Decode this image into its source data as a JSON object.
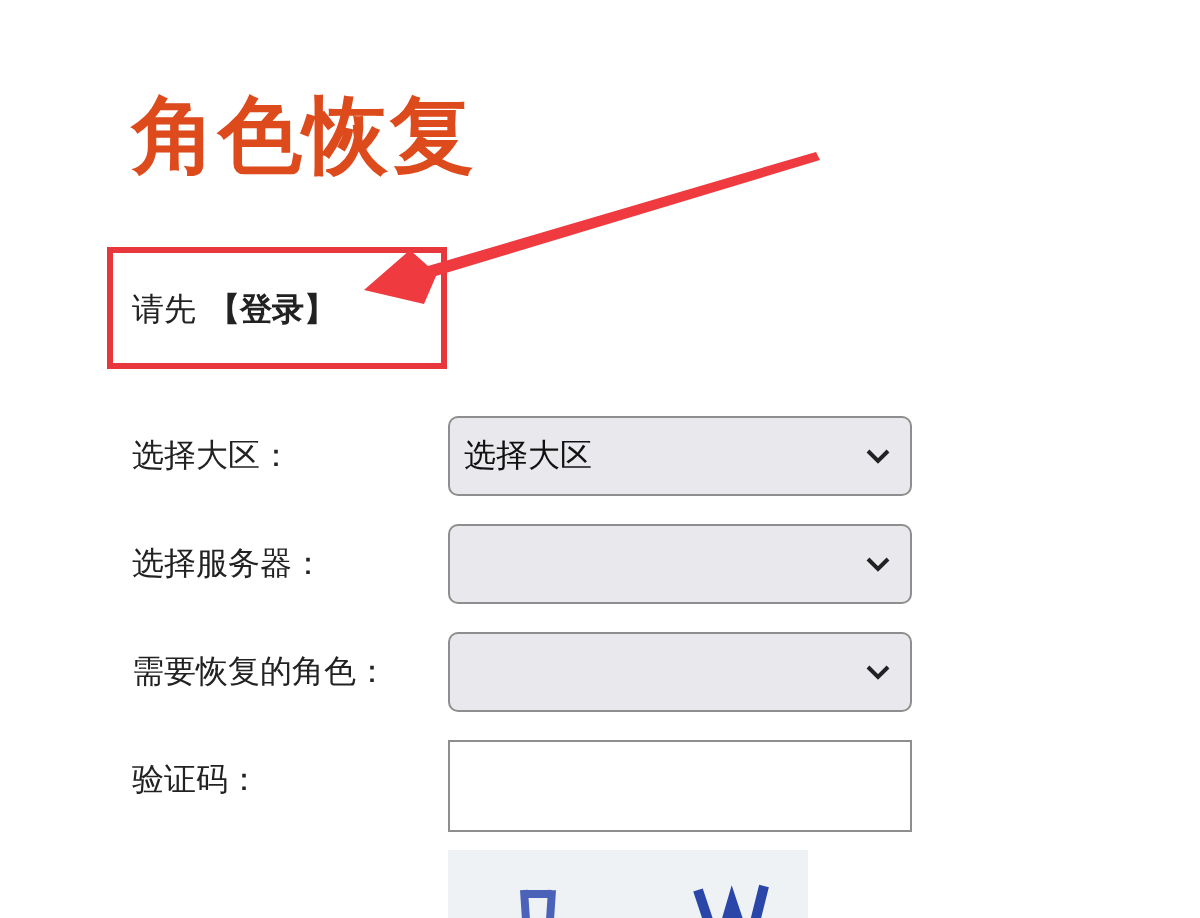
{
  "title": "角色恢复",
  "login_prompt": {
    "text": "请先",
    "link": "【登录】"
  },
  "fields": [
    {
      "kind": "select",
      "label": "选择大区：",
      "value": "选择大区"
    },
    {
      "kind": "select",
      "label": "选择服务器："
    },
    {
      "kind": "select",
      "label": "需要恢复的角色："
    },
    {
      "kind": "input",
      "label": "验证码："
    }
  ]
}
